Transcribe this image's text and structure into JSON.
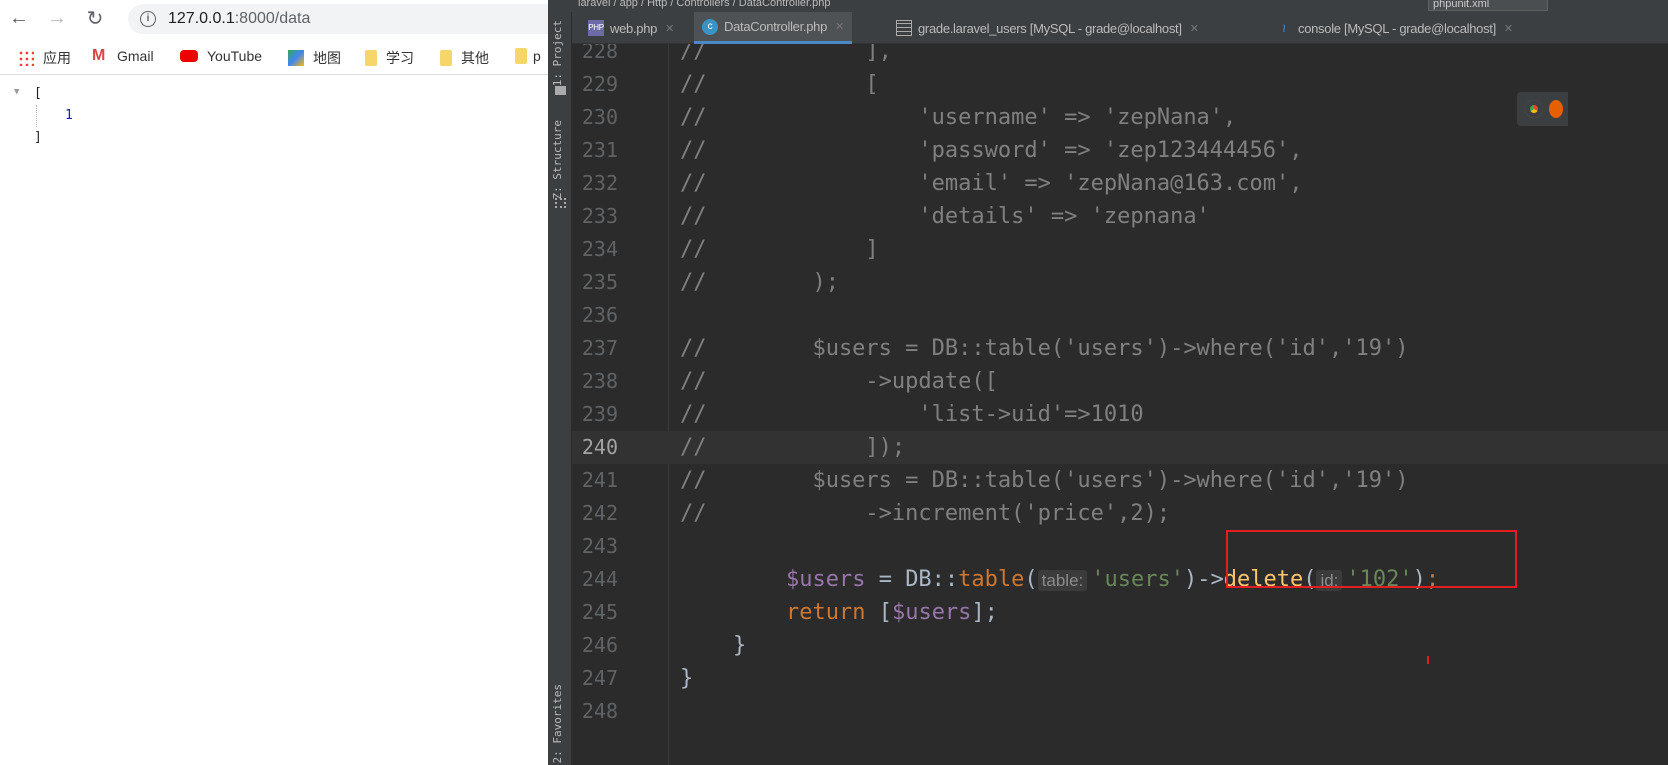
{
  "browser": {
    "url_host": "127.0.0.1",
    "url_rest": ":8000/data",
    "bookmarks": [
      {
        "label": "应用",
        "icon": "apps-icon"
      },
      {
        "label": "Gmail",
        "icon": "gmail-icon"
      },
      {
        "label": "YouTube",
        "icon": "youtube-icon"
      },
      {
        "label": "地图",
        "icon": "maps-icon"
      },
      {
        "label": "学习",
        "icon": "folder-icon"
      },
      {
        "label": "其他",
        "icon": "folder-icon"
      },
      {
        "label": "p",
        "icon": "folder-icon"
      }
    ],
    "json_open": "[",
    "json_value": "1",
    "json_close": "]"
  },
  "ide": {
    "breadcrumb": "laravel / app / Http / Controllers / DataController.php",
    "run_config": "phpunit.xml",
    "tool_windows": {
      "project": "1: Project",
      "structure": "Z: Structure",
      "favorites": "2: Favorites"
    },
    "tabs": [
      {
        "label": "web.php",
        "active": false
      },
      {
        "label": "DataController.php",
        "active": true
      },
      {
        "label": "grade.laravel_users [MySQL - grade@localhost]",
        "active": false
      },
      {
        "label": "console [MySQL - grade@localhost]",
        "active": false
      }
    ],
    "current_line": "240",
    "lines": [
      {
        "n": "228",
        "text": "//            ],"
      },
      {
        "n": "229",
        "text": "//            ["
      },
      {
        "n": "230",
        "text": "//                'username' => 'zepNana',"
      },
      {
        "n": "231",
        "text": "//                'password' => 'zep123444456',"
      },
      {
        "n": "232",
        "text": "//                'email' => 'zepNana@163.com',"
      },
      {
        "n": "233",
        "text": "//                'details' => 'zepnana'"
      },
      {
        "n": "234",
        "text": "//            ]"
      },
      {
        "n": "235",
        "text": "//        );"
      },
      {
        "n": "236",
        "text": ""
      },
      {
        "n": "237",
        "text": "//        $users = DB::table('users')->where('id','19')"
      },
      {
        "n": "238",
        "text": "//            ->update(["
      },
      {
        "n": "239",
        "text": "//                'list->uid'=>1010"
      },
      {
        "n": "240",
        "text": "//            ]);"
      },
      {
        "n": "241",
        "text": "//        $users = DB::table('users')->where('id','19')"
      },
      {
        "n": "242",
        "text": "//            ->increment('price',2);"
      },
      {
        "n": "243",
        "text": ""
      },
      {
        "n": "244",
        "text": ""
      },
      {
        "n": "245",
        "text": ""
      },
      {
        "n": "246",
        "text": "    }"
      },
      {
        "n": "247",
        "text": "}"
      },
      {
        "n": "248",
        "text": ""
      }
    ],
    "line244": {
      "indent": "        ",
      "var": "$users",
      "eq": " = DB::",
      "fn": "table",
      "open": "(",
      "hint1": "table:",
      "arg1": "'users'",
      "arrow": ")->",
      "call": "delete",
      "open2": "(",
      "hint2": "id:",
      "arg2": "'102'",
      "close": ")",
      "semi": ";"
    },
    "line245": {
      "indent": "        ",
      "kw": "return",
      "rest": " [",
      "var": "$users",
      "end": "];"
    }
  }
}
